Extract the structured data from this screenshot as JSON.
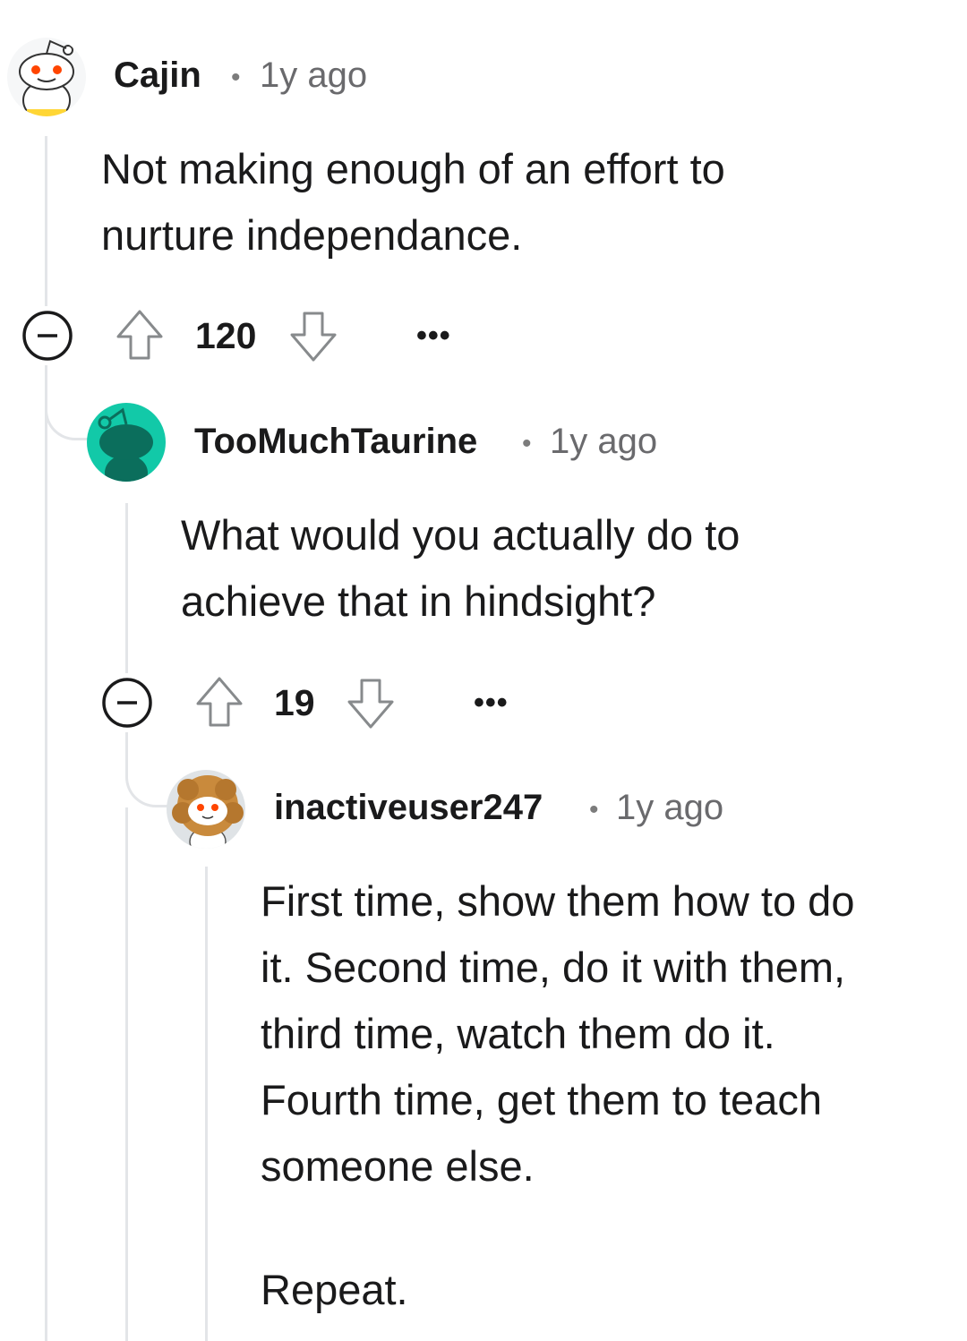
{
  "comments": [
    {
      "username": "Cajin",
      "separator": "•",
      "time": "1y ago",
      "body": [
        "Not making enough of an effort to",
        "nurture independance."
      ],
      "votes": "120",
      "more": "•••"
    },
    {
      "username": "TooMuchTaurine",
      "separator": "•",
      "time": "1y ago",
      "body": [
        "What would you actually do to",
        "achieve that in hindsight?"
      ],
      "votes": "19",
      "more": "•••"
    },
    {
      "username": "inactiveuser247",
      "separator": "•",
      "time": "1y ago",
      "body": [
        "First time, show them how to do",
        "it. Second time, do it with them,",
        "third time, watch them do it.",
        "Fourth time, get them to teach",
        "someone else.",
        "",
        "Repeat."
      ]
    }
  ],
  "icons": {
    "collapse": "collapse-minus-icon",
    "upvote": "upvote-arrow-icon",
    "downvote": "downvote-arrow-icon",
    "avatar_2_bg": "#12c9a8"
  }
}
